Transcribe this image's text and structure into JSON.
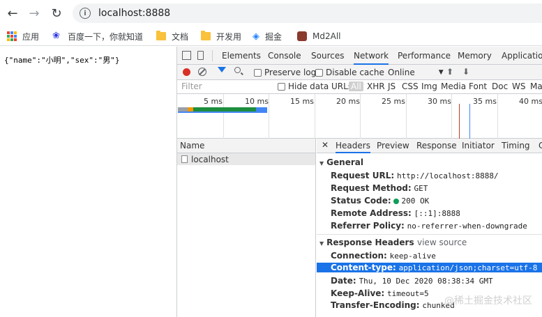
{
  "toolbar": {
    "url": "localhost:8888"
  },
  "bookmarks": [
    {
      "label": "应用",
      "icon": "apps-grid-icon"
    },
    {
      "label": "百度一下，你就知道",
      "icon": "baidu-paw-icon"
    },
    {
      "label": "文档",
      "icon": "folder-icon"
    },
    {
      "label": "开发用",
      "icon": "folder-icon"
    },
    {
      "label": "掘金",
      "icon": "juejin-icon"
    },
    {
      "label": "Md2All",
      "icon": "md2all-icon"
    }
  ],
  "page_content": {
    "json_text": "{\"name\":\"小明\",\"sex\":\"男\"}"
  },
  "devtools": {
    "tabs": [
      "Elements",
      "Console",
      "Sources",
      "Network",
      "Performance",
      "Memory",
      "Application"
    ],
    "active_tab": "Network",
    "network_toolbar": {
      "preserve_log": "Preserve log",
      "disable_cache": "Disable cache",
      "throttle": "Online"
    },
    "filter": {
      "placeholder": "Filter",
      "hide_data_urls": "Hide data URLs",
      "types": [
        "All",
        "XHR",
        "JS",
        "CSS",
        "Img",
        "Media",
        "Font",
        "Doc",
        "WS",
        "Ma"
      ]
    },
    "timeline": {
      "ticks": [
        "5 ms",
        "10 ms",
        "15 ms",
        "20 ms",
        "25 ms",
        "30 ms",
        "35 ms",
        "40 ms"
      ]
    },
    "requests": {
      "header": "Name",
      "rows": [
        "localhost"
      ]
    },
    "details": {
      "tabs": [
        "Headers",
        "Preview",
        "Response",
        "Initiator",
        "Timing",
        "C"
      ],
      "active_tab": "Headers",
      "general": {
        "title": "General",
        "request_url_k": "Request URL:",
        "request_url_v": "http://localhost:8888/",
        "method_k": "Request Method:",
        "method_v": "GET",
        "status_k": "Status Code:",
        "status_v": "200 OK",
        "remote_k": "Remote Address:",
        "remote_v": "[::1]:8888",
        "referrer_k": "Referrer Policy:",
        "referrer_v": "no-referrer-when-downgrade"
      },
      "response_headers": {
        "title": "Response Headers",
        "view_source": "view source",
        "connection_k": "Connection:",
        "connection_v": "keep-alive",
        "ctype_k": "Content-type:",
        "ctype_v": "application/json;charset=utf-8",
        "date_k": "Date:",
        "date_v": "Thu, 10 Dec 2020 08:38:34 GMT",
        "keepalive_k": "Keep-Alive:",
        "keepalive_v": "timeout=5",
        "te_k": "Transfer-Encoding:",
        "te_v": "chunked"
      }
    }
  },
  "watermark": "@稀土掘金技术社区"
}
